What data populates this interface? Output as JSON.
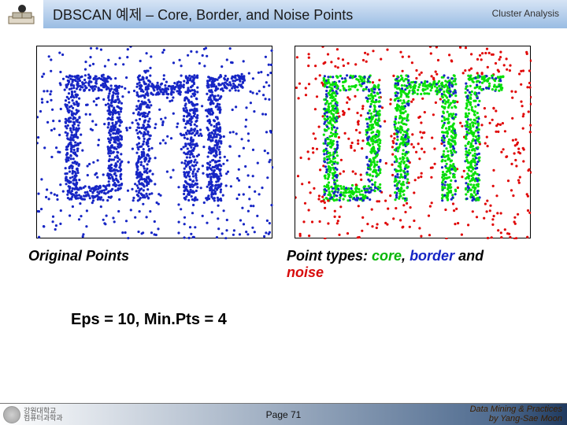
{
  "header": {
    "title": "DBSCAN 예제 – Core, Border, and Noise Points",
    "section": "Cluster Analysis"
  },
  "captions": {
    "left": "Original Points",
    "right_prefix": "Point types: ",
    "right_core": "core",
    "right_sep1": ", ",
    "right_border": "border",
    "right_sep2": " and ",
    "right_noise": "noise"
  },
  "params": "Eps = 10, Min.Pts = 4",
  "footer": {
    "page": "Page 71",
    "uni1": "강원대학교",
    "uni2": "컴퓨터과학과",
    "credit1": "Data Mining & Practices",
    "credit2": "by Yang-Sae Moon"
  },
  "chart_data": [
    {
      "type": "scatter",
      "title": "Original Points",
      "xlim": [
        0,
        1
      ],
      "ylim": [
        0,
        1
      ],
      "description": "Dense 2D point cloud forming the stylized letters D M arranged vertically with scattered background noise",
      "series": [
        {
          "name": "points",
          "color": "#1726c5",
          "n_approx": 2500
        }
      ]
    },
    {
      "type": "scatter",
      "title": "Point types: core, border and noise",
      "xlim": [
        0,
        1
      ],
      "ylim": [
        0,
        1
      ],
      "description": "Same point cloud with DBSCAN classification (Eps=10, MinPts=4): core points green (dense letter strokes), border points blue (edges of strokes), noise points red (sparse background)",
      "series": [
        {
          "name": "core",
          "color": "#08b608",
          "n_approx": 1900
        },
        {
          "name": "border",
          "color": "#1726c5",
          "n_approx": 250
        },
        {
          "name": "noise",
          "color": "#d80c0c",
          "n_approx": 350
        }
      ]
    }
  ]
}
